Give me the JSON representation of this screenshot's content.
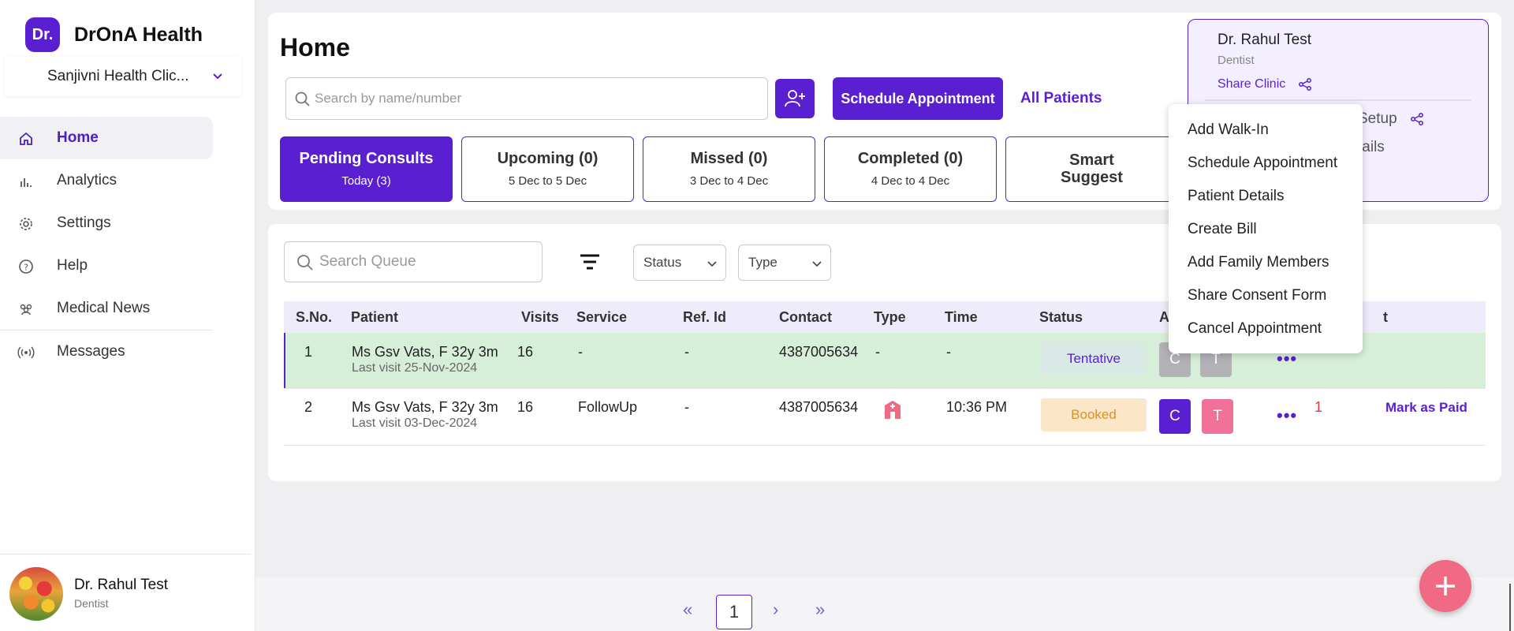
{
  "brand": {
    "logo": "Dr.",
    "name": "DrOnA Health"
  },
  "clinic": {
    "selected": "Sanjivni Health Clic..."
  },
  "nav": [
    {
      "label": "Home",
      "icon": "home-icon"
    },
    {
      "label": "Analytics",
      "icon": "analytics-icon"
    },
    {
      "label": "Settings",
      "icon": "gear-icon"
    },
    {
      "label": "Help",
      "icon": "help-icon"
    },
    {
      "label": "Medical News",
      "icon": "people-icon"
    },
    {
      "label": "Messages",
      "icon": "broadcast-icon"
    }
  ],
  "user": {
    "name": "Dr. Rahul Test",
    "role": "Dentist"
  },
  "page": {
    "title": "Home"
  },
  "search": {
    "placeholder": "Search by name/number"
  },
  "actions": {
    "schedule": "Schedule Appointment",
    "all_patients": "All Patients"
  },
  "tabs": [
    {
      "label": "Pending Consults",
      "sub": "Today (3)"
    },
    {
      "label": "Upcoming (0)",
      "sub": "5 Dec to 5 Dec"
    },
    {
      "label": "Missed (0)",
      "sub": "3 Dec to 4 Dec"
    },
    {
      "label": "Completed (0)",
      "sub": "4 Dec to 4 Dec"
    },
    {
      "label": "Smart",
      "label2": "Suggest"
    }
  ],
  "doctor_card": {
    "name": "Dr. Rahul Test",
    "role": "Dentist",
    "share": "Share Clinic",
    "setup": "Setup",
    "details": "tails"
  },
  "queue": {
    "search_placeholder": "Search Queue",
    "status_filter": "Status",
    "type_filter": "Type",
    "columns": [
      "S.No.",
      "Patient",
      "Visits",
      "Service",
      "Ref. Id",
      "Contact",
      "Type",
      "Time",
      "Status",
      "A",
      "t"
    ],
    "rows": [
      {
        "sno": "1",
        "patient": "Ms Gsv Vats, F 32y 3m",
        "last_visit": "Last visit 25-Nov-2024",
        "visits": "16",
        "service": "-",
        "ref": "-",
        "contact": "4387005634",
        "type": "-",
        "time": "-",
        "status": "Tentative",
        "c": "C",
        "t": "T",
        "more": "•••"
      },
      {
        "sno": "2",
        "patient": "Ms Gsv Vats, F 32y 3m",
        "last_visit": "Last visit 03-Dec-2024",
        "visits": "16",
        "service": "FollowUp",
        "ref": "-",
        "contact": "4387005634",
        "type_icon": "hospital-icon",
        "time": "10:36 PM",
        "status": "Booked",
        "c": "C",
        "t": "T",
        "more": "•••",
        "due": "1",
        "paid_label": "Mark as Paid"
      }
    ]
  },
  "menu": {
    "items": [
      "Add Walk-In",
      "Schedule Appointment",
      "Patient Details",
      "Create Bill",
      "Add Family Members",
      "Share Consent Form",
      "Cancel Appointment"
    ]
  },
  "pager": {
    "first": "«",
    "prev": "‹",
    "page": "1",
    "next": "›",
    "last": "»"
  },
  "colors": {
    "accent": "#5a1fd1",
    "tentative_bg": "#d8e9e6",
    "booked_bg": "#fbe7c7",
    "row_highlight": "#d6efd8",
    "fab": "#f06a84"
  }
}
